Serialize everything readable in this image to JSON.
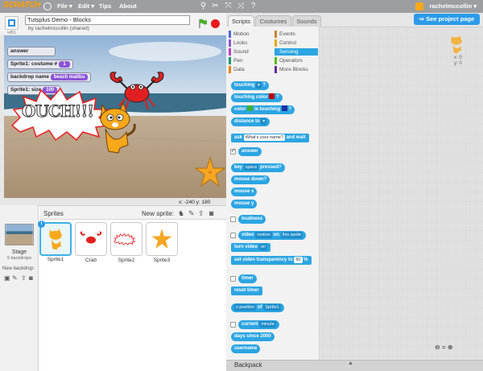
{
  "topbar": {
    "logo": "SCRATCH",
    "menus": [
      "File ▾",
      "Edit ▾",
      "Tips",
      "About"
    ],
    "username": "rachelmccollin ▾"
  },
  "stage": {
    "title": "Tutsplus Demo - Blocks",
    "author": "by rachelmccollin (shared)",
    "version": "v451",
    "monitors": [
      {
        "label": "answer",
        "value": ""
      },
      {
        "label": "Sprite1: costume #",
        "value": "1"
      },
      {
        "label": "backdrop name",
        "value": "beach malibu"
      },
      {
        "label": "Sprite1: size",
        "value": "100"
      }
    ],
    "speech": "OUCH!!!",
    "coords": "x: -240  y: 180"
  },
  "sprites": {
    "header": "Sprites",
    "new_sprite": "New sprite:",
    "stage_label": "Stage",
    "backdrops": "5 backdrops",
    "new_backdrop": "New backdrop:",
    "items": [
      {
        "name": "Sprite1"
      },
      {
        "name": "Crab"
      },
      {
        "name": "Sprite2"
      },
      {
        "name": "Sprite3"
      }
    ]
  },
  "tabs": [
    "Scripts",
    "Costumes",
    "Sounds"
  ],
  "share_button": "See project page",
  "categories": [
    {
      "name": "Motion",
      "color": "#4a6cd4"
    },
    {
      "name": "Events",
      "color": "#c88330"
    },
    {
      "name": "Looks",
      "color": "#8a55d7"
    },
    {
      "name": "Control",
      "color": "#e1a91a"
    },
    {
      "name": "Sound",
      "color": "#bb42c3"
    },
    {
      "name": "Sensing",
      "color": "#2ca5e2"
    },
    {
      "name": "Pen",
      "color": "#0e9a6c"
    },
    {
      "name": "Operators",
      "color": "#5cb712"
    },
    {
      "name": "Data",
      "color": "#ee7d16"
    },
    {
      "name": "More Blocks",
      "color": "#632d99"
    }
  ],
  "blocks": {
    "touching": "touching",
    "touching_color": "touching color",
    "color_touching_a": "color",
    "color_touching_b": "is touching",
    "distance_to": "distance to",
    "ask": "ask",
    "ask_slot": "What's your name?",
    "ask_wait": "and wait",
    "answer": "answer",
    "key": "key",
    "key_slot": "space",
    "pressed": "pressed?",
    "mouse_down": "mouse down?",
    "mouse_x": "mouse x",
    "mouse_y": "mouse y",
    "loudness": "loudness",
    "video": "video",
    "video_slot": "motion",
    "video_on": "on",
    "video_target": "this sprite",
    "turn_video": "turn video",
    "turn_video_slot": "on",
    "set_video_a": "set video transparency to",
    "set_video_val": "50",
    "set_video_b": "%",
    "timer": "timer",
    "reset_timer": "reset timer",
    "xpos": "x position",
    "of": "of",
    "of_target": "Sprite1",
    "current": "current",
    "current_slot": "minute",
    "days": "days since 2000",
    "username": "username"
  },
  "script_area": {
    "x": "x: 0",
    "y": "y: 0",
    "zoom": "⊖ = ⊕"
  },
  "backpack": "Backpack"
}
